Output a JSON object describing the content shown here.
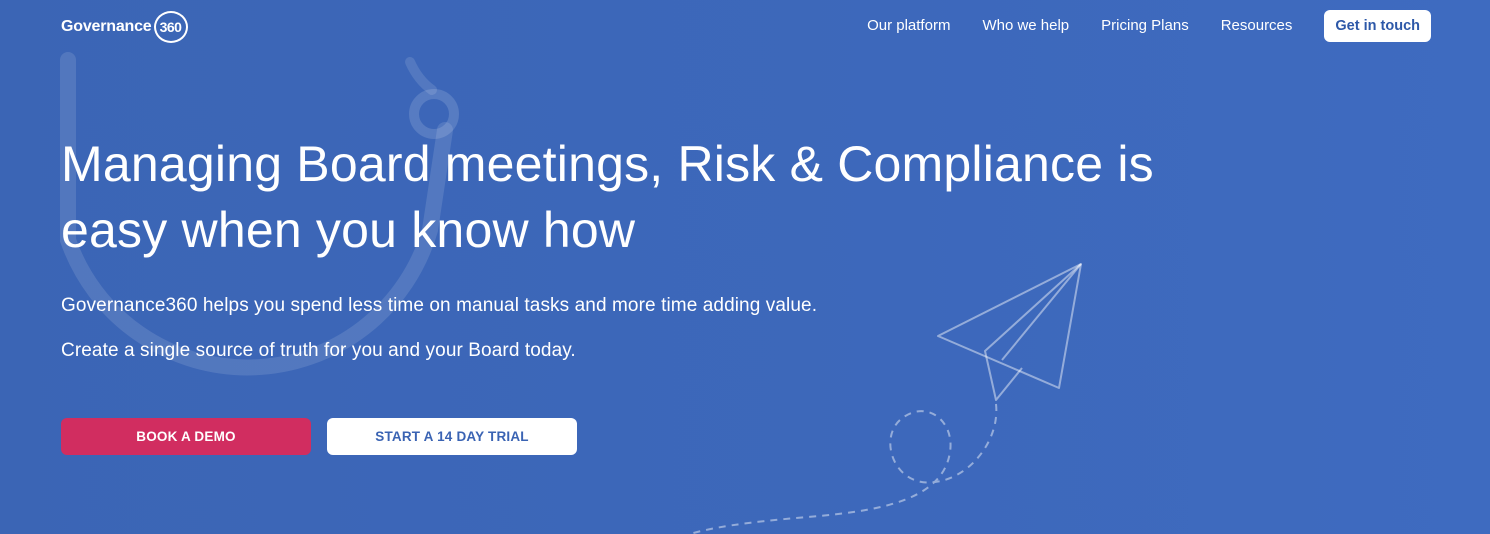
{
  "brand": {
    "name": "Governance",
    "badge": "360"
  },
  "nav": {
    "links": [
      "Our platform",
      "Who we help",
      "Pricing Plans",
      "Resources"
    ],
    "cta": "Get in touch"
  },
  "hero": {
    "headline_line1": "Managing Board meetings, Risk & Compliance is",
    "headline_line2": "easy when you know how",
    "subtext1": "Governance360 helps you spend less time on manual tasks and more time adding value.",
    "subtext2": "Create a single source of truth for you and your Board today.",
    "primary_button": "BOOK A DEMO",
    "secondary_button": "START A 14 DAY TRIAL"
  },
  "colors": {
    "background": "#3c67b9",
    "primary_button": "#d12d60",
    "secondary_button": "#ffffff",
    "cta_text": "#2d58a8"
  },
  "icons": [
    "paper-plane-icon",
    "dashed-flight-path",
    "decorative-arc"
  ]
}
